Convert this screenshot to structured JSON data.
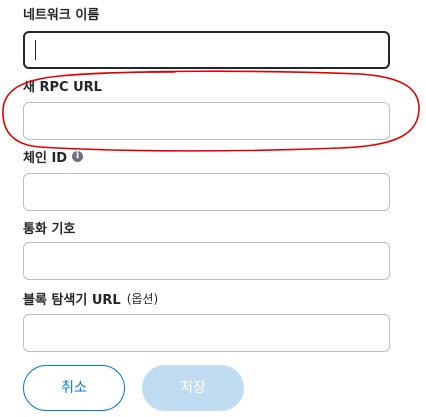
{
  "form": {
    "network_name": {
      "label": "네트워크 이름",
      "value": "",
      "placeholder": ""
    },
    "rpc_url": {
      "label": "새 RPC URL",
      "value": "",
      "placeholder": ""
    },
    "chain_id": {
      "label": "체인 ID",
      "info_icon": "info-icon",
      "value": "",
      "placeholder": ""
    },
    "currency_symbol": {
      "label": "통화 기호",
      "value": "",
      "placeholder": ""
    },
    "block_explorer": {
      "label": "블록 탐색기 URL",
      "optional_label": "(옵션)",
      "value": "",
      "placeholder": ""
    }
  },
  "actions": {
    "cancel_label": "취소",
    "save_label": "저장"
  },
  "colors": {
    "primary": "#037dd6",
    "disabled_primary": "#bfdcf3",
    "annotation": "#e00000",
    "border": "#bbc0c5",
    "text": "#24272a"
  }
}
